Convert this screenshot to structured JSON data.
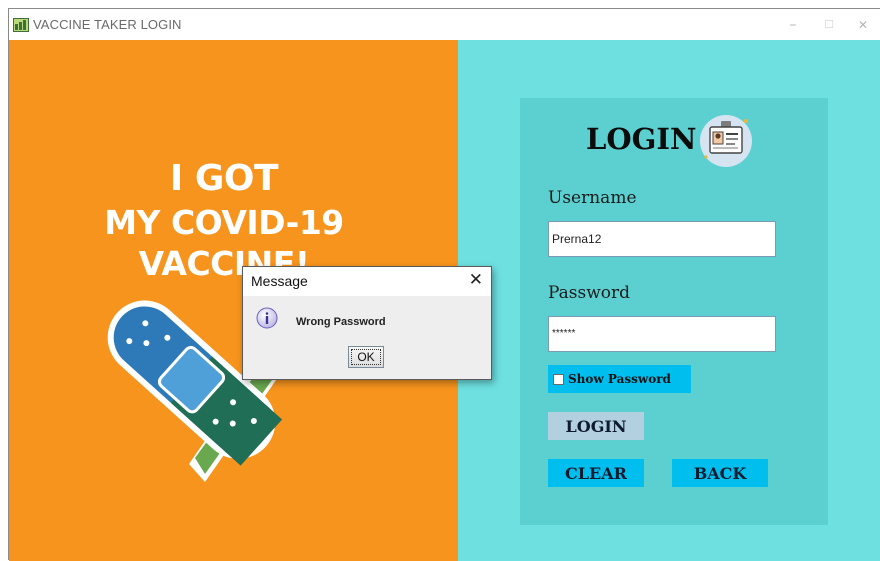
{
  "window": {
    "title": "VACCINE TAKER LOGIN",
    "minimize_glyph": "–",
    "maximize_glyph": "☐",
    "close_glyph": "✕"
  },
  "poster": {
    "line1": "I GOT",
    "line2": "MY COVID-19",
    "line3": "VACCINE!",
    "background_color": "#f7941d"
  },
  "login": {
    "heading": "LOGIN",
    "username_label": "Username",
    "username_value": "Prerna12",
    "password_label": "Password",
    "password_value": "******",
    "show_password_label": "Show Password",
    "show_password_checked": false,
    "login_button": "LOGIN",
    "clear_button": "CLEAR",
    "back_button": "BACK",
    "panel_color": "#6ee0e0",
    "card_color": "#5cd0d0"
  },
  "dialog": {
    "title": "Message",
    "close_glyph": "✕",
    "message": "Wrong Password",
    "ok_button": "OK"
  },
  "icons": {
    "app": "app-icon",
    "badge": "id-badge-icon",
    "info": "info-icon",
    "bandage": "bandage-checkmark-icon"
  }
}
